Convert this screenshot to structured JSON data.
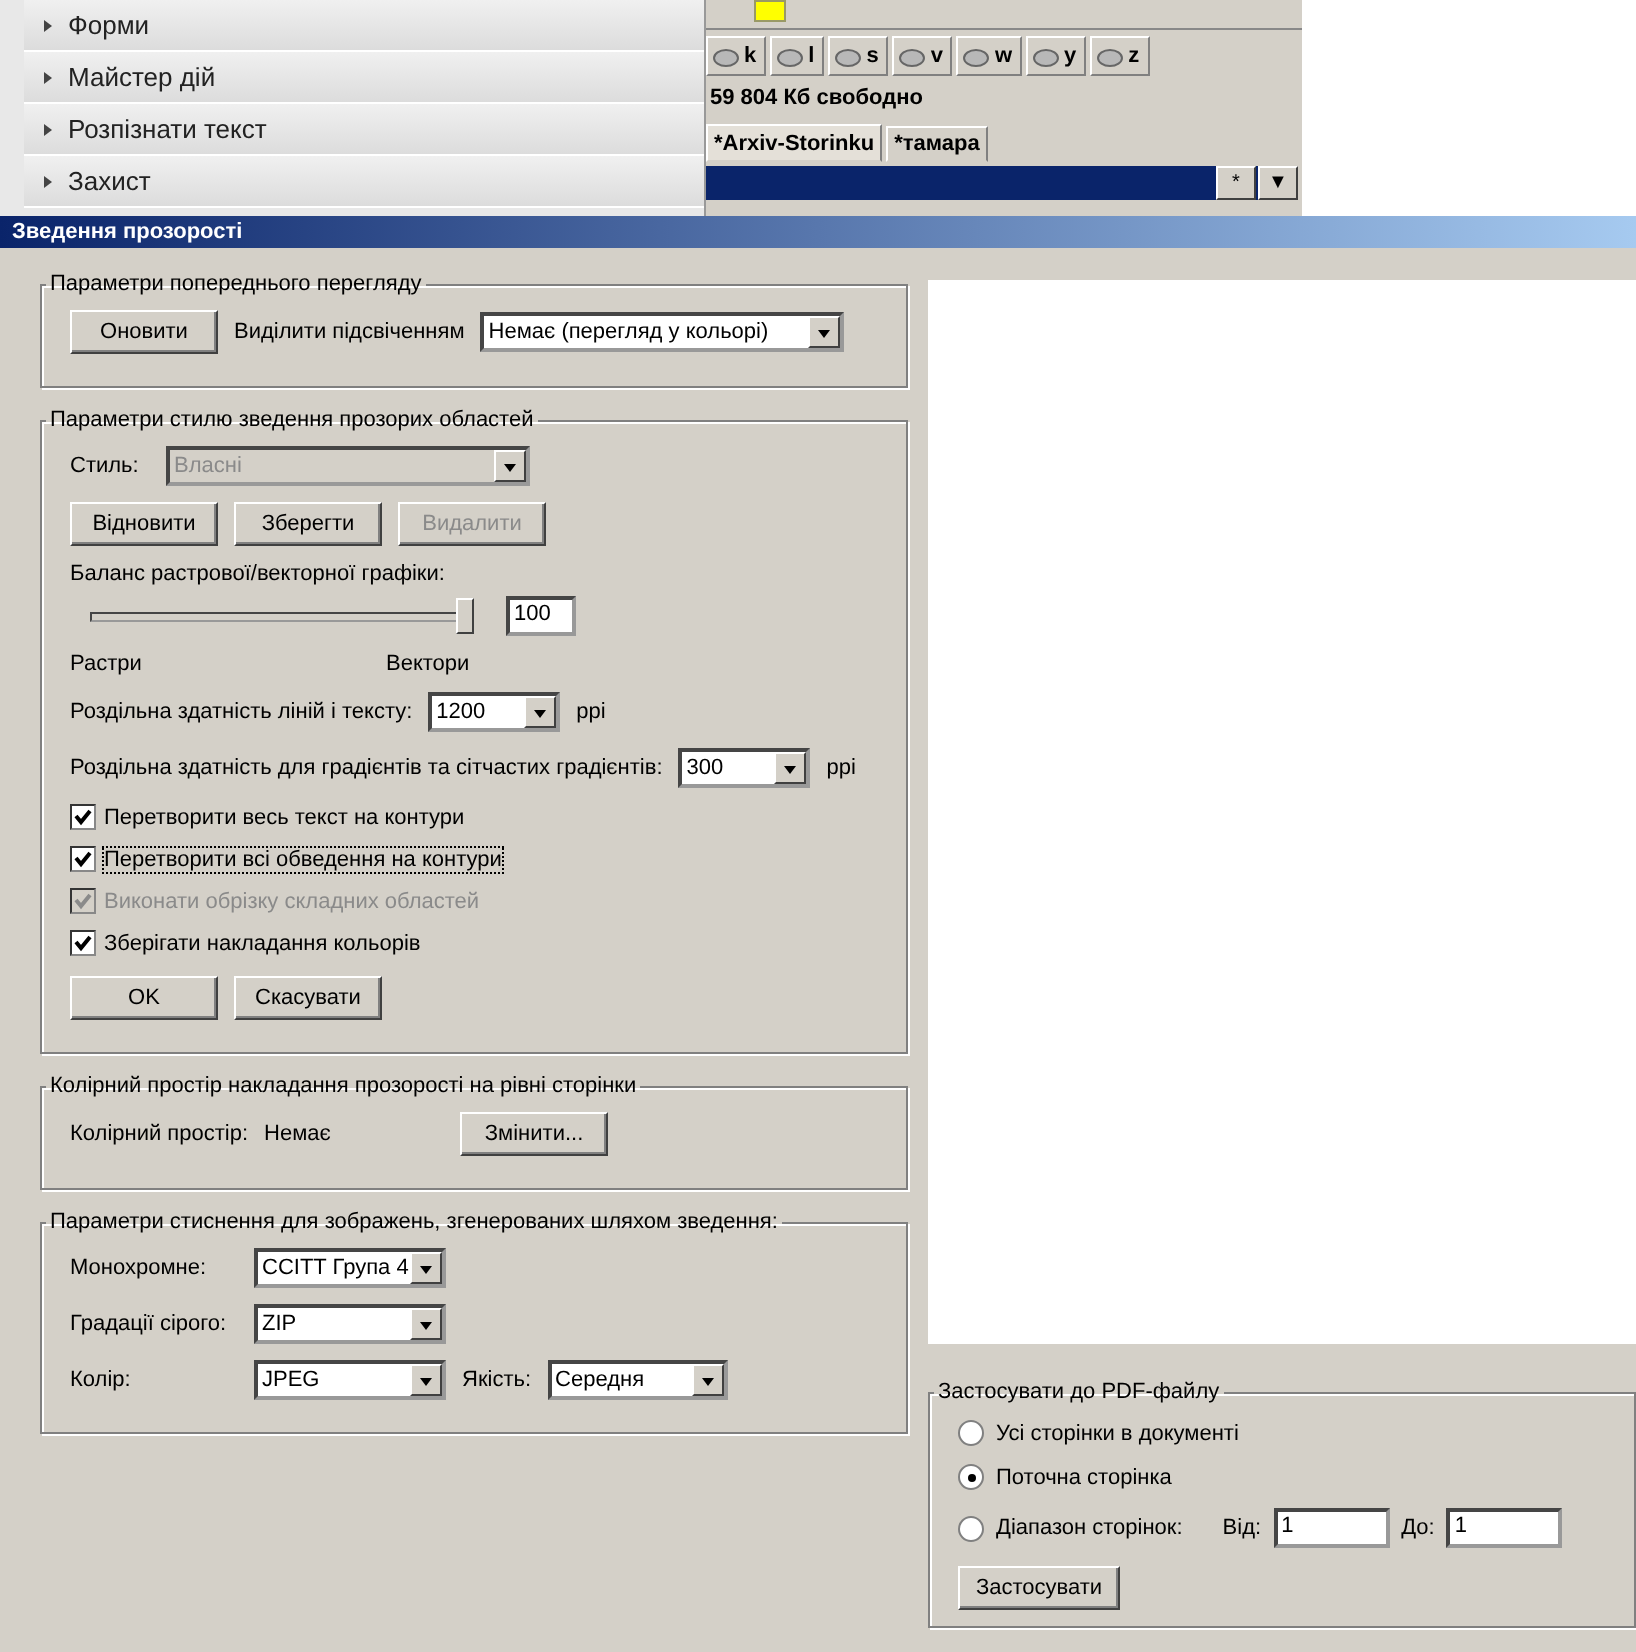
{
  "background": {
    "accordion": [
      {
        "label": "Форми"
      },
      {
        "label": "Майстер дій"
      },
      {
        "label": "Розпізнати текст"
      },
      {
        "label": "Захист"
      }
    ],
    "drives": [
      {
        "letter": "k"
      },
      {
        "letter": "l"
      },
      {
        "letter": "s"
      },
      {
        "letter": "v"
      },
      {
        "letter": "w"
      },
      {
        "letter": "y"
      },
      {
        "letter": "z"
      }
    ],
    "free_space": "59 804 Кб свободно",
    "tabs": [
      {
        "label": "*Arxiv-Storinku",
        "selected": true
      },
      {
        "label": "*тамара",
        "selected": false
      }
    ],
    "path_bar_buttons": [
      "*",
      "▼"
    ]
  },
  "dialog": {
    "title": "Зведення прозорості",
    "preview_group": {
      "title": "Параметри попереднього перегляду",
      "refresh_button": "Оновити",
      "highlight_label": "Виділити підсвіченням",
      "highlight_value": "Немає (перегляд у кольорі)"
    },
    "style_group": {
      "title": "Параметри стилю зведення прозорих областей",
      "style_label": "Стиль:",
      "style_value": "Власні",
      "style_disabled": true,
      "buttons": [
        {
          "label": "Відновити",
          "disabled": false
        },
        {
          "label": "Зберегти",
          "disabled": false
        },
        {
          "label": "Видалити",
          "disabled": true
        }
      ],
      "balance_label": "Баланс растрової/векторної графіки:",
      "balance_slider": {
        "level": 1
      },
      "balance_value": "100",
      "raster_label": "Растри",
      "vector_label": "Вектори",
      "line_res_label": "Роздільна здатність ліній і тексту:",
      "line_res_value": "1200",
      "line_res_unit": "ppi",
      "grad_res_label": "Роздільна здатність для градієнтів та сітчастих градієнтів:",
      "grad_res_value": "300",
      "grad_res_unit": "ppi",
      "options": [
        {
          "label": "Перетворити весь текст на контури",
          "checked": true,
          "disabled": false,
          "focused": false
        },
        {
          "label": "Перетворити всі обведення на контури",
          "checked": true,
          "disabled": false,
          "focused": true
        },
        {
          "label": "Виконати обрізку складних областей",
          "checked": true,
          "disabled": true,
          "focused": false
        },
        {
          "label": "Зберігати накладання кольорів",
          "checked": true,
          "disabled": false,
          "focused": false
        }
      ],
      "ok_button": "OK",
      "cancel_button": "Скасувати"
    },
    "color_space_group": {
      "title": "Колірний простір накладання прозорості на рівні сторінки",
      "label": "Колірний простір:",
      "value": "Немає",
      "change_button": "Змінити..."
    },
    "compression_group": {
      "title": "Параметри стиснення для зображень, згенерованих шляхом зведення:",
      "mono_label": "Монохромне:",
      "mono_value": "CCITT Група 4",
      "gray_label": "Градації сірого:",
      "gray_value": "ZIP",
      "color_label": "Колір:",
      "color_value": "JPEG",
      "quality_label": "Якість:",
      "quality_value": "Середня"
    },
    "apply_group": {
      "title": "Застосувати до PDF-файлу",
      "options": [
        {
          "label": "Усі сторінки в документі",
          "selected": false
        },
        {
          "label": "Поточна сторінка",
          "selected": true
        },
        {
          "label": "Діапазон сторінок:",
          "selected": false
        }
      ],
      "from_label": "Від:",
      "from_value": "1",
      "to_label": "До:",
      "to_value": "1",
      "apply_button": "Застосувати"
    }
  }
}
